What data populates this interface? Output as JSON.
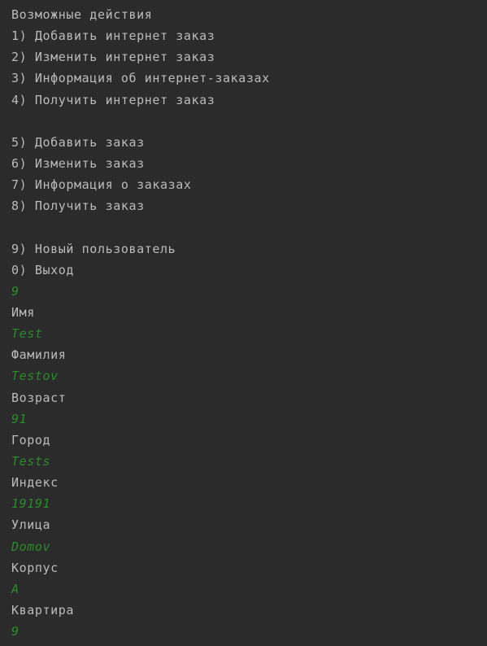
{
  "console": {
    "colors": {
      "background": "#2b2b2b",
      "output_text": "#bbbbbb",
      "user_input": "#2b8a2b"
    },
    "lines": [
      {
        "kind": "output",
        "text": "Возможные действия"
      },
      {
        "kind": "output",
        "text": "1) Добавить интернет заказ"
      },
      {
        "kind": "output",
        "text": "2) Изменить интернет заказ"
      },
      {
        "kind": "output",
        "text": "3) Информация об интернет-заказах"
      },
      {
        "kind": "output",
        "text": "4) Получить интернет заказ"
      },
      {
        "kind": "blank",
        "text": ""
      },
      {
        "kind": "output",
        "text": "5) Добавить заказ"
      },
      {
        "kind": "output",
        "text": "6) Изменить заказ"
      },
      {
        "kind": "output",
        "text": "7) Информация о заказах"
      },
      {
        "kind": "output",
        "text": "8) Получить заказ"
      },
      {
        "kind": "blank",
        "text": ""
      },
      {
        "kind": "output",
        "text": "9) Новый пользователь"
      },
      {
        "kind": "output",
        "text": "0) Выход"
      },
      {
        "kind": "input",
        "text": "9"
      },
      {
        "kind": "output",
        "text": "Имя"
      },
      {
        "kind": "input",
        "text": "Test"
      },
      {
        "kind": "output",
        "text": "Фамилия"
      },
      {
        "kind": "input",
        "text": "Testov"
      },
      {
        "kind": "output",
        "text": "Возраст"
      },
      {
        "kind": "input",
        "text": "91"
      },
      {
        "kind": "output",
        "text": "Город"
      },
      {
        "kind": "input",
        "text": "Tests"
      },
      {
        "kind": "output",
        "text": "Индекс"
      },
      {
        "kind": "input",
        "text": "19191"
      },
      {
        "kind": "output",
        "text": "Улица"
      },
      {
        "kind": "input",
        "text": "Domov"
      },
      {
        "kind": "output",
        "text": "Корпус"
      },
      {
        "kind": "input",
        "text": "A"
      },
      {
        "kind": "output",
        "text": "Квартира"
      },
      {
        "kind": "input",
        "text": "9"
      }
    ]
  }
}
